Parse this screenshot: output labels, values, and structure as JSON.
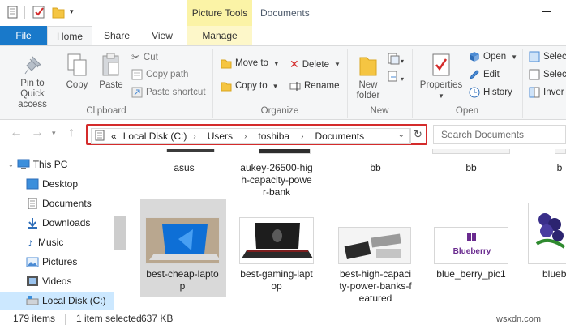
{
  "titlebar": {
    "contextual_tab": "Picture Tools",
    "window_title": "Documents"
  },
  "tabs": {
    "file": "File",
    "home": "Home",
    "share": "Share",
    "view": "View",
    "manage": "Manage"
  },
  "ribbon": {
    "clipboard": {
      "label": "Clipboard",
      "pin": "Pin to Quick access",
      "copy": "Copy",
      "paste": "Paste",
      "cut": "Cut",
      "copy_path": "Copy path",
      "paste_shortcut": "Paste shortcut"
    },
    "organize": {
      "label": "Organize",
      "move_to": "Move to",
      "copy_to": "Copy to",
      "delete": "Delete",
      "rename": "Rename"
    },
    "new": {
      "label": "New",
      "new_folder": "New folder"
    },
    "open": {
      "label": "Open",
      "properties": "Properties",
      "open": "Open",
      "edit": "Edit",
      "history": "History"
    },
    "select": {
      "select_all": "Selec",
      "select_none": "Selec",
      "invert": "Inver"
    }
  },
  "address": {
    "prefix": "«",
    "crumbs": [
      "Local Disk (C:)",
      "Users",
      "toshiba",
      "Documents"
    ],
    "search_placeholder": "Search Documents"
  },
  "navpane": {
    "items": [
      "This PC",
      "Desktop",
      "Documents",
      "Downloads",
      "Music",
      "Pictures",
      "Videos",
      "Local Disk (C:)"
    ]
  },
  "files": {
    "row1": [
      "asus",
      "aukey-26500-high-capacity-power-bank",
      "bb",
      "bb",
      "b"
    ],
    "row1_lines": {
      "asus": [
        "asus"
      ],
      "aukey": [
        "aukey-26500-hig",
        "h-capacity-powe",
        "r-bank"
      ],
      "bb1": [
        "bb"
      ],
      "bb2": [
        "bb"
      ],
      "b": [
        "b"
      ]
    },
    "row2": {
      "f1": [
        "best-cheap-lapto",
        "p"
      ],
      "f2": [
        "best-gaming-lapt",
        "op"
      ],
      "f3": [
        "best-high-capaci",
        "ty-power-banks-f",
        "eatured"
      ],
      "f4": [
        "blue_berry_pic1"
      ],
      "f5": [
        "blueb"
      ]
    },
    "blueberry_logo": "Blueberry"
  },
  "status": {
    "count": "179 items",
    "selected": "1 item selected",
    "size": "637 KB"
  },
  "watermark": "wsxdn.com",
  "colors": {
    "file_tab": "#1979ca",
    "picture_tools": "#fbf3a6",
    "address_highlight": "#d42b2b",
    "selected_nav": "#cce8ff"
  }
}
